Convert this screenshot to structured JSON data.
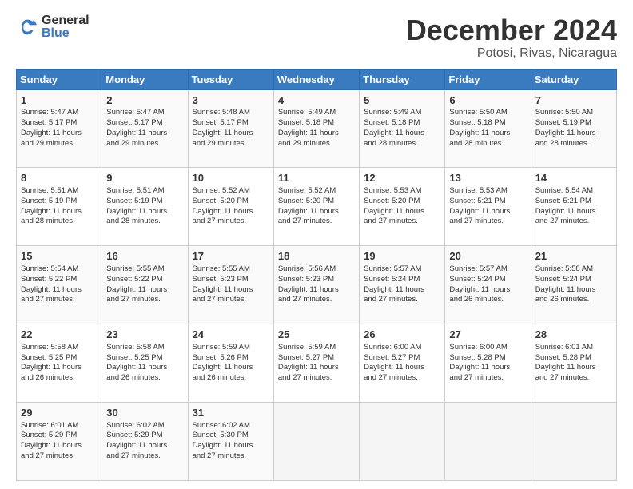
{
  "logo": {
    "general": "General",
    "blue": "Blue"
  },
  "title": "December 2024",
  "location": "Potosi, Rivas, Nicaragua",
  "weekdays": [
    "Sunday",
    "Monday",
    "Tuesday",
    "Wednesday",
    "Thursday",
    "Friday",
    "Saturday"
  ],
  "weeks": [
    [
      {
        "day": "1",
        "info": "Sunrise: 5:47 AM\nSunset: 5:17 PM\nDaylight: 11 hours\nand 29 minutes."
      },
      {
        "day": "2",
        "info": "Sunrise: 5:47 AM\nSunset: 5:17 PM\nDaylight: 11 hours\nand 29 minutes."
      },
      {
        "day": "3",
        "info": "Sunrise: 5:48 AM\nSunset: 5:17 PM\nDaylight: 11 hours\nand 29 minutes."
      },
      {
        "day": "4",
        "info": "Sunrise: 5:49 AM\nSunset: 5:18 PM\nDaylight: 11 hours\nand 29 minutes."
      },
      {
        "day": "5",
        "info": "Sunrise: 5:49 AM\nSunset: 5:18 PM\nDaylight: 11 hours\nand 28 minutes."
      },
      {
        "day": "6",
        "info": "Sunrise: 5:50 AM\nSunset: 5:18 PM\nDaylight: 11 hours\nand 28 minutes."
      },
      {
        "day": "7",
        "info": "Sunrise: 5:50 AM\nSunset: 5:19 PM\nDaylight: 11 hours\nand 28 minutes."
      }
    ],
    [
      {
        "day": "8",
        "info": "Sunrise: 5:51 AM\nSunset: 5:19 PM\nDaylight: 11 hours\nand 28 minutes."
      },
      {
        "day": "9",
        "info": "Sunrise: 5:51 AM\nSunset: 5:19 PM\nDaylight: 11 hours\nand 28 minutes."
      },
      {
        "day": "10",
        "info": "Sunrise: 5:52 AM\nSunset: 5:20 PM\nDaylight: 11 hours\nand 27 minutes."
      },
      {
        "day": "11",
        "info": "Sunrise: 5:52 AM\nSunset: 5:20 PM\nDaylight: 11 hours\nand 27 minutes."
      },
      {
        "day": "12",
        "info": "Sunrise: 5:53 AM\nSunset: 5:20 PM\nDaylight: 11 hours\nand 27 minutes."
      },
      {
        "day": "13",
        "info": "Sunrise: 5:53 AM\nSunset: 5:21 PM\nDaylight: 11 hours\nand 27 minutes."
      },
      {
        "day": "14",
        "info": "Sunrise: 5:54 AM\nSunset: 5:21 PM\nDaylight: 11 hours\nand 27 minutes."
      }
    ],
    [
      {
        "day": "15",
        "info": "Sunrise: 5:54 AM\nSunset: 5:22 PM\nDaylight: 11 hours\nand 27 minutes."
      },
      {
        "day": "16",
        "info": "Sunrise: 5:55 AM\nSunset: 5:22 PM\nDaylight: 11 hours\nand 27 minutes."
      },
      {
        "day": "17",
        "info": "Sunrise: 5:55 AM\nSunset: 5:23 PM\nDaylight: 11 hours\nand 27 minutes."
      },
      {
        "day": "18",
        "info": "Sunrise: 5:56 AM\nSunset: 5:23 PM\nDaylight: 11 hours\nand 27 minutes."
      },
      {
        "day": "19",
        "info": "Sunrise: 5:57 AM\nSunset: 5:24 PM\nDaylight: 11 hours\nand 27 minutes."
      },
      {
        "day": "20",
        "info": "Sunrise: 5:57 AM\nSunset: 5:24 PM\nDaylight: 11 hours\nand 26 minutes."
      },
      {
        "day": "21",
        "info": "Sunrise: 5:58 AM\nSunset: 5:24 PM\nDaylight: 11 hours\nand 26 minutes."
      }
    ],
    [
      {
        "day": "22",
        "info": "Sunrise: 5:58 AM\nSunset: 5:25 PM\nDaylight: 11 hours\nand 26 minutes."
      },
      {
        "day": "23",
        "info": "Sunrise: 5:58 AM\nSunset: 5:25 PM\nDaylight: 11 hours\nand 26 minutes."
      },
      {
        "day": "24",
        "info": "Sunrise: 5:59 AM\nSunset: 5:26 PM\nDaylight: 11 hours\nand 26 minutes."
      },
      {
        "day": "25",
        "info": "Sunrise: 5:59 AM\nSunset: 5:27 PM\nDaylight: 11 hours\nand 27 minutes."
      },
      {
        "day": "26",
        "info": "Sunrise: 6:00 AM\nSunset: 5:27 PM\nDaylight: 11 hours\nand 27 minutes."
      },
      {
        "day": "27",
        "info": "Sunrise: 6:00 AM\nSunset: 5:28 PM\nDaylight: 11 hours\nand 27 minutes."
      },
      {
        "day": "28",
        "info": "Sunrise: 6:01 AM\nSunset: 5:28 PM\nDaylight: 11 hours\nand 27 minutes."
      }
    ],
    [
      {
        "day": "29",
        "info": "Sunrise: 6:01 AM\nSunset: 5:29 PM\nDaylight: 11 hours\nand 27 minutes."
      },
      {
        "day": "30",
        "info": "Sunrise: 6:02 AM\nSunset: 5:29 PM\nDaylight: 11 hours\nand 27 minutes."
      },
      {
        "day": "31",
        "info": "Sunrise: 6:02 AM\nSunset: 5:30 PM\nDaylight: 11 hours\nand 27 minutes."
      },
      {
        "day": "",
        "info": ""
      },
      {
        "day": "",
        "info": ""
      },
      {
        "day": "",
        "info": ""
      },
      {
        "day": "",
        "info": ""
      }
    ]
  ]
}
